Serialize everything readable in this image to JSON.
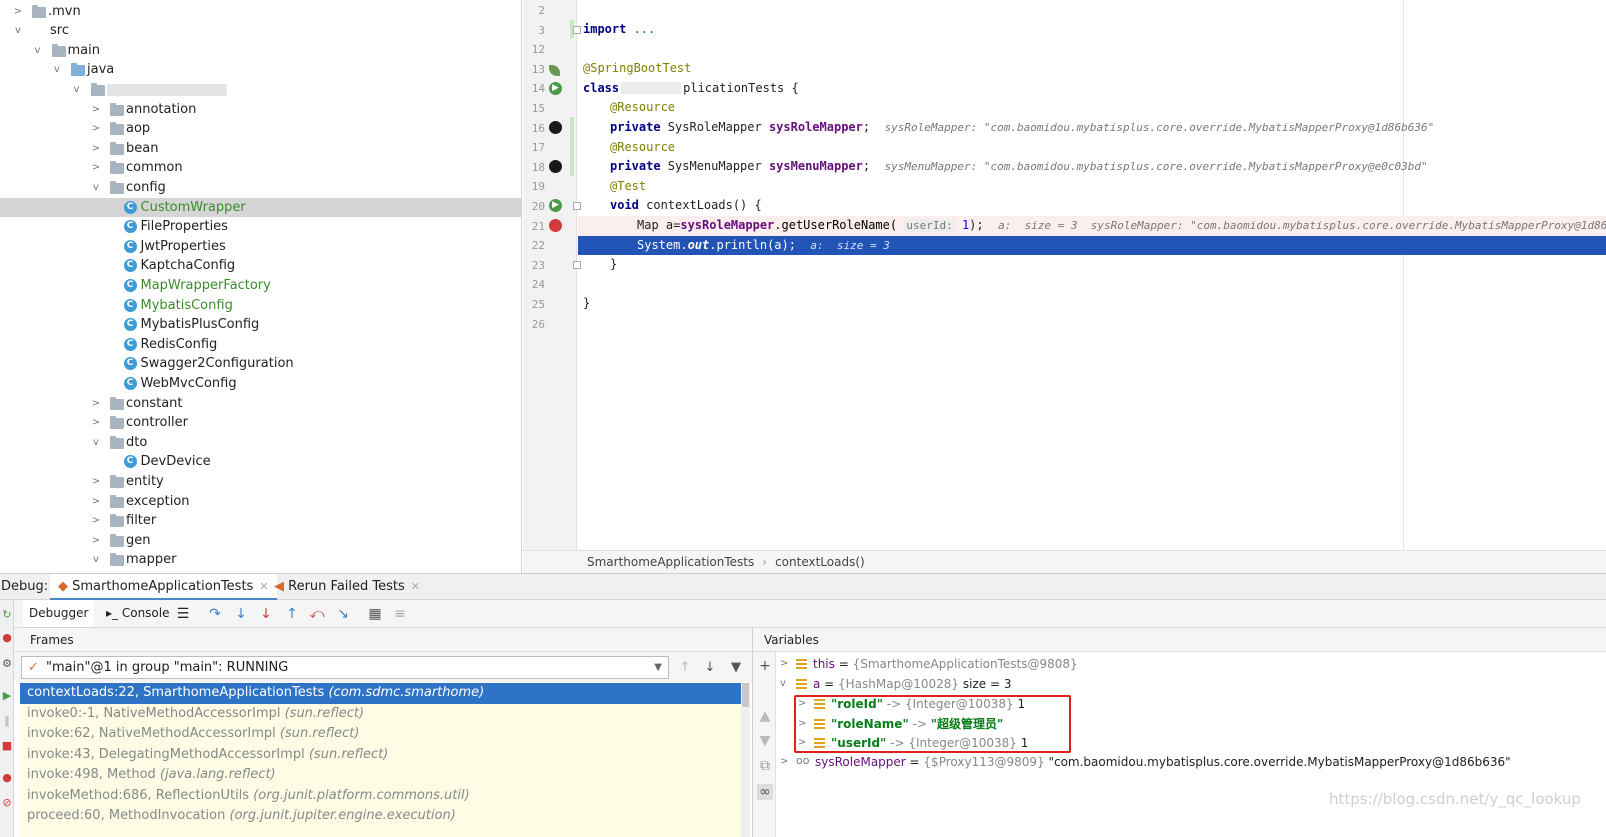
{
  "tree": {
    "items": [
      {
        "label": ".mvn",
        "depth": 0,
        "state": "collapsed",
        "kind": "folder"
      },
      {
        "label": "src",
        "depth": 0,
        "state": "expanded",
        "kind": "none"
      },
      {
        "label": "main",
        "depth": 1,
        "state": "expanded",
        "kind": "folder"
      },
      {
        "label": "java",
        "depth": 2,
        "state": "expanded",
        "kind": "folder-blue"
      },
      {
        "label": "",
        "depth": 3,
        "state": "expanded",
        "kind": "package-blurred"
      },
      {
        "label": "annotation",
        "depth": 4,
        "state": "collapsed",
        "kind": "folder"
      },
      {
        "label": "aop",
        "depth": 4,
        "state": "collapsed",
        "kind": "folder"
      },
      {
        "label": "bean",
        "depth": 4,
        "state": "collapsed",
        "kind": "folder"
      },
      {
        "label": "common",
        "depth": 4,
        "state": "collapsed",
        "kind": "folder"
      },
      {
        "label": "config",
        "depth": 4,
        "state": "expanded",
        "kind": "folder"
      },
      {
        "label": "CustomWrapper",
        "depth": 5,
        "state": "leaf",
        "kind": "class",
        "green": true,
        "selected": true
      },
      {
        "label": "FileProperties",
        "depth": 5,
        "state": "leaf",
        "kind": "class"
      },
      {
        "label": "JwtProperties",
        "depth": 5,
        "state": "leaf",
        "kind": "class"
      },
      {
        "label": "KaptchaConfig",
        "depth": 5,
        "state": "leaf",
        "kind": "class"
      },
      {
        "label": "MapWrapperFactory",
        "depth": 5,
        "state": "leaf",
        "kind": "class",
        "green": true
      },
      {
        "label": "MybatisConfig",
        "depth": 5,
        "state": "leaf",
        "kind": "class",
        "green": true
      },
      {
        "label": "MybatisPlusConfig",
        "depth": 5,
        "state": "leaf",
        "kind": "class"
      },
      {
        "label": "RedisConfig",
        "depth": 5,
        "state": "leaf",
        "kind": "class"
      },
      {
        "label": "Swagger2Configuration",
        "depth": 5,
        "state": "leaf",
        "kind": "class"
      },
      {
        "label": "WebMvcConfig",
        "depth": 5,
        "state": "leaf",
        "kind": "class"
      },
      {
        "label": "constant",
        "depth": 4,
        "state": "collapsed",
        "kind": "folder"
      },
      {
        "label": "controller",
        "depth": 4,
        "state": "collapsed",
        "kind": "folder"
      },
      {
        "label": "dto",
        "depth": 4,
        "state": "expanded",
        "kind": "folder"
      },
      {
        "label": "DevDevice",
        "depth": 5,
        "state": "leaf",
        "kind": "class"
      },
      {
        "label": "entity",
        "depth": 4,
        "state": "collapsed",
        "kind": "folder"
      },
      {
        "label": "exception",
        "depth": 4,
        "state": "collapsed",
        "kind": "folder"
      },
      {
        "label": "filter",
        "depth": 4,
        "state": "collapsed",
        "kind": "folder"
      },
      {
        "label": "gen",
        "depth": 4,
        "state": "collapsed",
        "kind": "folder"
      },
      {
        "label": "mapper",
        "depth": 4,
        "state": "expanded",
        "kind": "folder"
      }
    ]
  },
  "editor": {
    "line_numbers": [
      "2",
      "3",
      "12",
      "13",
      "14",
      "15",
      "16",
      "17",
      "18",
      "19",
      "20",
      "21",
      "22",
      "23",
      "24",
      "25",
      "26"
    ],
    "code": {
      "l3_kw": "import",
      "l3_rest": " ...",
      "l13_ann": "@SpringBootTest",
      "l14_kw": "class",
      "l14_rest": "plicationTests {",
      "l15_ann": "@Resource",
      "l16_kw": "private",
      "l16_type": " SysRoleMapper ",
      "l16_field": "sysRoleMapper",
      "l16_semi": ";",
      "l16_hint": "sysRoleMapper: \"com.baomidou.mybatisplus.core.override.MybatisMapperProxy@1d86b636\"",
      "l17_ann": "@Resource",
      "l18_kw": "private",
      "l18_type": " SysMenuMapper ",
      "l18_field": "sysMenuMapper",
      "l18_semi": ";",
      "l18_hint": "sysMenuMapper: \"com.baomidou.mybatisplus.core.override.MybatisMapperProxy@e0c03bd\"",
      "l19_ann": "@Test",
      "l20_kw": "void",
      "l20_rest": " contextLoads() {",
      "l21_pre": "Map a=",
      "l21_field": "sysRoleMapper",
      "l21_call": ".getUserRoleName(",
      "l21_param": "userId:",
      "l21_num": "1",
      "l21_end": ");",
      "l21_hint": "a:  size = 3  sysRoleMapper: \"com.baomidou.mybatisplus.core.override.MybatisMapperProxy@1d86b636\"",
      "l22_pre": "System.",
      "l22_out": "out",
      "l22_rest": ".println(a);",
      "l22_hint": "a:  size = 3",
      "l23": "}",
      "l25": "}"
    }
  },
  "breadcrumb": {
    "class_name": "SmarthomeApplicationTests",
    "method": "contextLoads()"
  },
  "debug": {
    "label": "Debug:",
    "tab_main": "SmarthomeApplicationTests",
    "tab_rerun": "Rerun Failed Tests",
    "sub_debugger": "Debugger",
    "sub_console": "Console",
    "frames_title": "Frames",
    "variables_title": "Variables",
    "thread": "\"main\"@1 in group \"main\": RUNNING",
    "frames": [
      {
        "method": "contextLoads:22, SmarthomeApplicationTests",
        "pkg": "(com.sdmc.smarthome)"
      },
      {
        "method": "invoke0:-1, NativeMethodAccessorImpl",
        "pkg": "(sun.reflect)"
      },
      {
        "method": "invoke:62, NativeMethodAccessorImpl",
        "pkg": "(sun.reflect)"
      },
      {
        "method": "invoke:43, DelegatingMethodAccessorImpl",
        "pkg": "(sun.reflect)"
      },
      {
        "method": "invoke:498, Method",
        "pkg": "(java.lang.reflect)"
      },
      {
        "method": "invokeMethod:686, ReflectionUtils",
        "pkg": "(org.junit.platform.commons.util)"
      },
      {
        "method": "proceed:60, MethodInvocation",
        "pkg": "(org.junit.jupiter.engine.execution)"
      }
    ],
    "variables": {
      "this_name": "this",
      "this_eq": " = ",
      "this_val": "{SmarthomeApplicationTests@9808}",
      "a_name": "a",
      "a_eq": " = ",
      "a_val": "{HashMap@10028}",
      "a_size": "size = 3",
      "entries": [
        {
          "key": "\"roleId\"",
          "arrow": " -> ",
          "type": "{Integer@10038}",
          "value": "1",
          "is_str": false
        },
        {
          "key": "\"roleName\"",
          "arrow": " -> ",
          "type": "",
          "value": "\"超级管理员\"",
          "is_str": true
        },
        {
          "key": "\"userId\"",
          "arrow": " -> ",
          "type": "{Integer@10038}",
          "value": "1",
          "is_str": false
        }
      ],
      "mapper_name": "sysRoleMapper",
      "mapper_eq": " = ",
      "mapper_type": "{$Proxy113@9809}",
      "mapper_val": "\"com.baomidou.mybatisplus.core.override.MybatisMapperProxy@1d86b636\""
    }
  },
  "watermark": "https://blog.csdn.net/y_qc_lookup",
  "colors": {
    "selection": "#2f73c6",
    "current_line": "#2154b5",
    "highlight_box": "#e02020",
    "annotation": "#808000",
    "field": "#660e7a"
  }
}
